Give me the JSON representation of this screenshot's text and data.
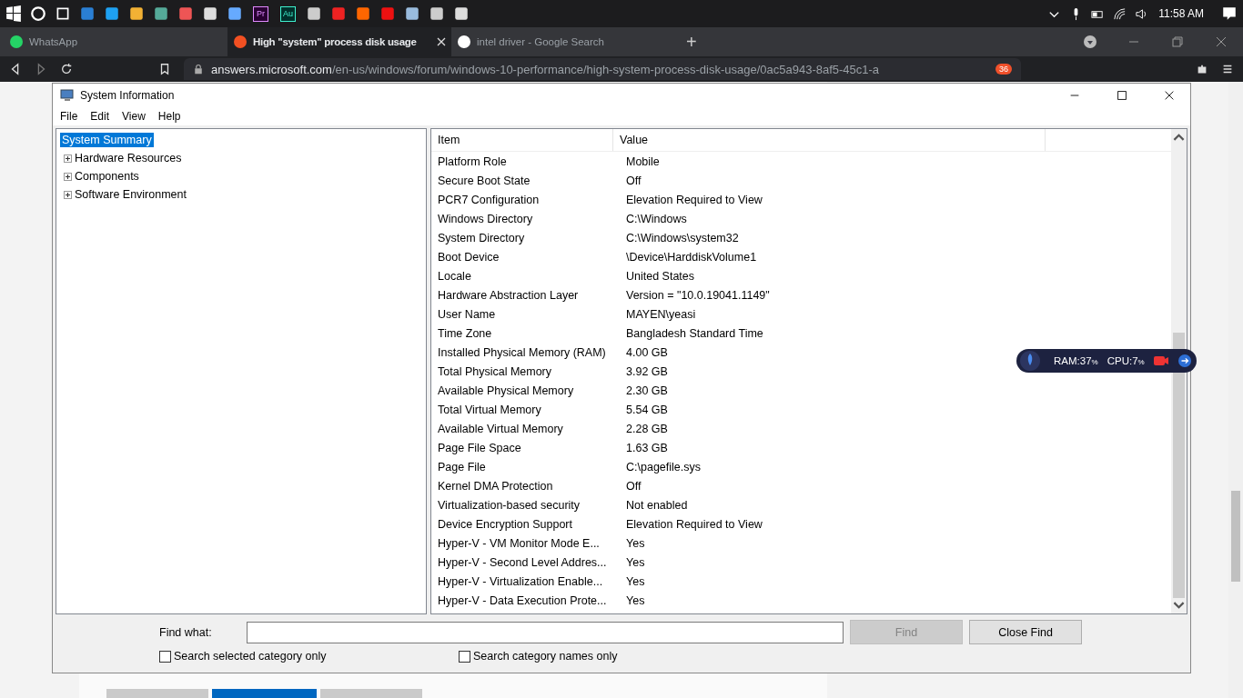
{
  "taskbar": {
    "app_labels": [
      "Pr",
      "Au"
    ],
    "clock": "11:58 AM"
  },
  "browser": {
    "tabs": [
      {
        "label": "WhatsApp",
        "selected": false
      },
      {
        "label": "High \"system\" process disk usage",
        "selected": true
      },
      {
        "label": "intel driver - Google Search",
        "selected": false
      }
    ],
    "new_tab": "+",
    "url_host": "answers.microsoft.com",
    "url_path": "/en-us/windows/forum/windows-10-performance/high-system-process-disk-usage/0ac5a943-8af5-45c1-a",
    "shields_count": "36"
  },
  "window": {
    "title": "System Information",
    "menu": [
      "File",
      "Edit",
      "View",
      "Help"
    ],
    "tree": [
      {
        "label": "System Summary",
        "selected": true,
        "expandable": false
      },
      {
        "label": "Hardware Resources",
        "selected": false,
        "expandable": true
      },
      {
        "label": "Components",
        "selected": false,
        "expandable": true
      },
      {
        "label": "Software Environment",
        "selected": false,
        "expandable": true
      }
    ],
    "table": {
      "columns": [
        "Item",
        "Value"
      ],
      "rows": [
        [
          "Platform Role",
          "Mobile"
        ],
        [
          "Secure Boot State",
          "Off"
        ],
        [
          "PCR7 Configuration",
          "Elevation Required to View"
        ],
        [
          "Windows Directory",
          "C:\\Windows"
        ],
        [
          "System Directory",
          "C:\\Windows\\system32"
        ],
        [
          "Boot Device",
          "\\Device\\HarddiskVolume1"
        ],
        [
          "Locale",
          "United States"
        ],
        [
          "Hardware Abstraction Layer",
          "Version = \"10.0.19041.1149\""
        ],
        [
          "User Name",
          "MAYEN\\yeasi"
        ],
        [
          "Time Zone",
          "Bangladesh Standard Time"
        ],
        [
          "Installed Physical Memory (RAM)",
          "4.00 GB"
        ],
        [
          "Total Physical Memory",
          "3.92 GB"
        ],
        [
          "Available Physical Memory",
          "2.30 GB"
        ],
        [
          "Total Virtual Memory",
          "5.54 GB"
        ],
        [
          "Available Virtual Memory",
          "2.28 GB"
        ],
        [
          "Page File Space",
          "1.63 GB"
        ],
        [
          "Page File",
          "C:\\pagefile.sys"
        ],
        [
          "Kernel DMA Protection",
          "Off"
        ],
        [
          "Virtualization-based security",
          "Not enabled"
        ],
        [
          "Device Encryption Support",
          "Elevation Required to View"
        ],
        [
          "Hyper-V - VM Monitor Mode E...",
          "Yes"
        ],
        [
          "Hyper-V - Second Level Addres...",
          "Yes"
        ],
        [
          "Hyper-V - Virtualization Enable...",
          "Yes"
        ],
        [
          "Hyper-V - Data Execution Prote...",
          "Yes"
        ]
      ]
    },
    "find": {
      "label": "Find what:",
      "find_button": {
        "label": "Find",
        "disabled": true
      },
      "close_button": {
        "label": "Close Find",
        "disabled": false
      },
      "options": [
        {
          "label": "Search selected category only",
          "checked": false
        },
        {
          "label": "Search category names only",
          "checked": false
        }
      ]
    }
  },
  "monitor_widget": {
    "ram": "RAM:37",
    "cpu": "CPU:7",
    "unit": "%"
  }
}
